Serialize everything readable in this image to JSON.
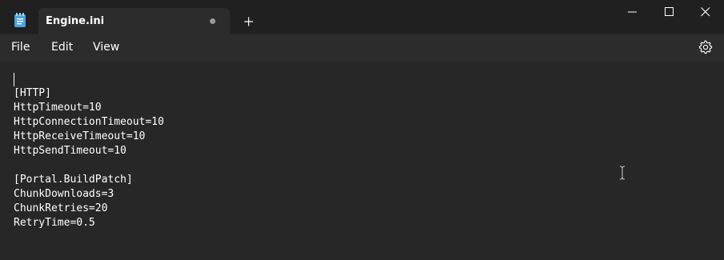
{
  "titlebar": {
    "tab_title": "Engine.ini",
    "icons": {
      "app": "notepad-icon",
      "unsaved": "unsaved-dot-icon",
      "new_tab": "plus-icon",
      "minimize": "minimize-icon",
      "maximize": "maximize-icon",
      "close": "close-icon"
    }
  },
  "menubar": {
    "file": "File",
    "edit": "Edit",
    "view": "View",
    "settings_icon": "gear-icon"
  },
  "editor": {
    "content": "[HTTP]\nHttpTimeout=10\nHttpConnectionTimeout=10\nHttpReceiveTimeout=10\nHttpSendTimeout=10\n\n[Portal.BuildPatch]\nChunkDownloads=3\nChunkRetries=20\nRetryTime=0.5"
  },
  "colors": {
    "titlebar_bg": "#202020",
    "tab_bg": "#2c2c2c",
    "menubar_bg": "#2c2c2c",
    "editor_bg": "#272727",
    "text": "#ffffff",
    "app_icon_blue": "#4aa3df"
  }
}
